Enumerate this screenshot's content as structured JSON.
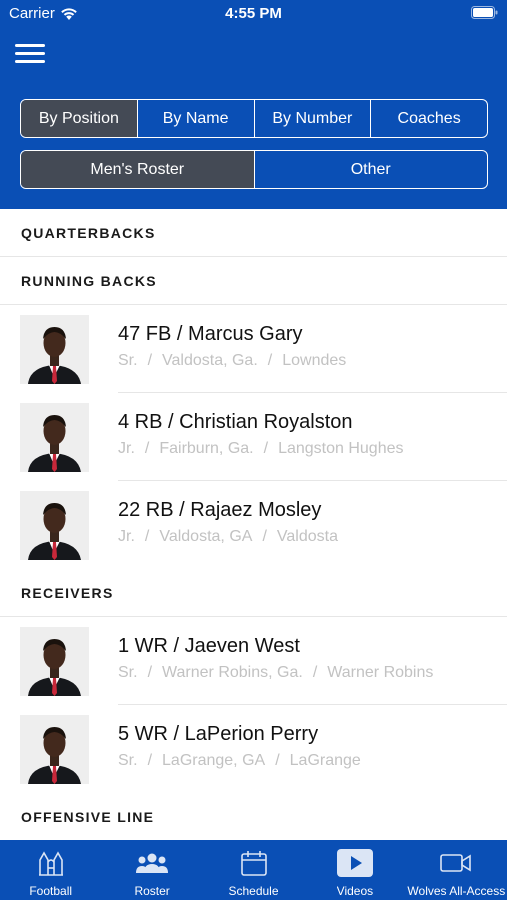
{
  "status_bar": {
    "carrier": "Carrier",
    "time": "4:55 PM"
  },
  "header": {
    "tabs": [
      {
        "label": "By Position",
        "active": true
      },
      {
        "label": "By Name",
        "active": false
      },
      {
        "label": "By Number",
        "active": false
      },
      {
        "label": "Coaches",
        "active": false
      }
    ],
    "roster_tabs": [
      {
        "label": "Men's Roster",
        "active": true
      },
      {
        "label": "Other",
        "active": false
      }
    ]
  },
  "sections": [
    {
      "title": "QUARTERBACKS",
      "players": []
    },
    {
      "title": "RUNNING BACKS",
      "players": [
        {
          "name": "47 FB / Marcus Gary",
          "year": "Sr.",
          "hometown": "Valdosta, Ga.",
          "school": "Lowndes"
        },
        {
          "name": "4 RB / Christian Royalston",
          "year": "Jr.",
          "hometown": "Fairburn, Ga.",
          "school": "Langston Hughes"
        },
        {
          "name": "22 RB / Rajaez Mosley",
          "year": "Jr.",
          "hometown": "Valdosta, GA",
          "school": "Valdosta"
        }
      ]
    },
    {
      "title": "RECEIVERS",
      "players": [
        {
          "name": "1 WR / Jaeven West",
          "year": "Sr.",
          "hometown": "Warner Robins, Ga.",
          "school": "Warner Robins"
        },
        {
          "name": "5 WR / LaPerion Perry",
          "year": "Sr.",
          "hometown": "LaGrange, GA",
          "school": "LaGrange"
        }
      ]
    },
    {
      "title": "OFFENSIVE LINE",
      "players": []
    }
  ],
  "meta_separator": "/",
  "tab_bar": [
    {
      "label": "Football",
      "icon": "stadium-icon"
    },
    {
      "label": "Roster",
      "icon": "team-icon"
    },
    {
      "label": "Schedule",
      "icon": "calendar-icon"
    },
    {
      "label": "Videos",
      "icon": "play-icon"
    },
    {
      "label": "Wolves All-Access",
      "icon": "video-camera-icon"
    }
  ],
  "colors": {
    "brand_blue": "#0a4fb5",
    "active_segment": "#444a55",
    "meta_gray": "#c2c2c2"
  }
}
